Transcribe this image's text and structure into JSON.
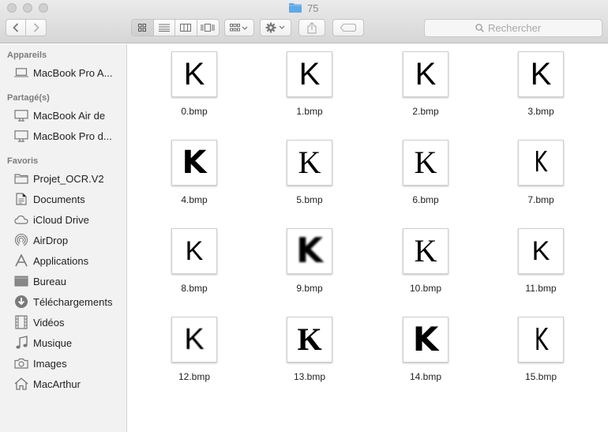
{
  "window": {
    "title": "75"
  },
  "toolbar": {
    "search_placeholder": "Rechercher",
    "view_modes": [
      "icon-view",
      "list-view",
      "column-view",
      "coverflow-view"
    ],
    "active_view": "icon-view"
  },
  "sidebar": {
    "sections": [
      {
        "title": "Appareils",
        "items": [
          {
            "label": "MacBook Pro A...",
            "icon": "laptop-icon"
          }
        ]
      },
      {
        "title": "Partagé(s)",
        "items": [
          {
            "label": "MacBook Air de",
            "icon": "display-icon"
          },
          {
            "label": "MacBook Pro d...",
            "icon": "display-icon"
          }
        ]
      },
      {
        "title": "Favoris",
        "items": [
          {
            "label": "Projet_OCR.V2",
            "icon": "folder-icon"
          },
          {
            "label": "Documents",
            "icon": "document-icon"
          },
          {
            "label": "iCloud Drive",
            "icon": "cloud-icon"
          },
          {
            "label": "AirDrop",
            "icon": "airdrop-icon"
          },
          {
            "label": "Applications",
            "icon": "applications-icon"
          },
          {
            "label": "Bureau",
            "icon": "desktop-icon"
          },
          {
            "label": "Téléchargements",
            "icon": "download-icon"
          },
          {
            "label": "Vidéos",
            "icon": "film-icon"
          },
          {
            "label": "Musique",
            "icon": "music-icon"
          },
          {
            "label": "Images",
            "icon": "camera-icon"
          },
          {
            "label": "MacArthur",
            "icon": "home-icon"
          }
        ]
      }
    ]
  },
  "files": [
    {
      "name": "0.bmp",
      "glyph": "K",
      "style": "sans"
    },
    {
      "name": "1.bmp",
      "glyph": "K",
      "style": "sans"
    },
    {
      "name": "2.bmp",
      "glyph": "K",
      "style": "sans"
    },
    {
      "name": "3.bmp",
      "glyph": "K",
      "style": "sans"
    },
    {
      "name": "4.bmp",
      "glyph": "K",
      "style": "bold"
    },
    {
      "name": "5.bmp",
      "glyph": "K",
      "style": "serif"
    },
    {
      "name": "6.bmp",
      "glyph": "K",
      "style": "serif"
    },
    {
      "name": "7.bmp",
      "glyph": "K",
      "style": "thin"
    },
    {
      "name": "8.bmp",
      "glyph": "K",
      "style": "sans"
    },
    {
      "name": "9.bmp",
      "glyph": "K",
      "style": "blur-bold"
    },
    {
      "name": "10.bmp",
      "glyph": "K",
      "style": "serif"
    },
    {
      "name": "11.bmp",
      "glyph": "K",
      "style": "sans"
    },
    {
      "name": "12.bmp",
      "glyph": "K",
      "style": "sans"
    },
    {
      "name": "13.bmp",
      "glyph": "K",
      "style": "serif-bold"
    },
    {
      "name": "14.bmp",
      "glyph": "K",
      "style": "bold"
    },
    {
      "name": "15.bmp",
      "glyph": "K",
      "style": "thin"
    }
  ],
  "colors": {
    "folder_blue": "#5fa9e6",
    "sidebar_bg": "#f2f2f2",
    "section_title": "#7c7c7c"
  }
}
